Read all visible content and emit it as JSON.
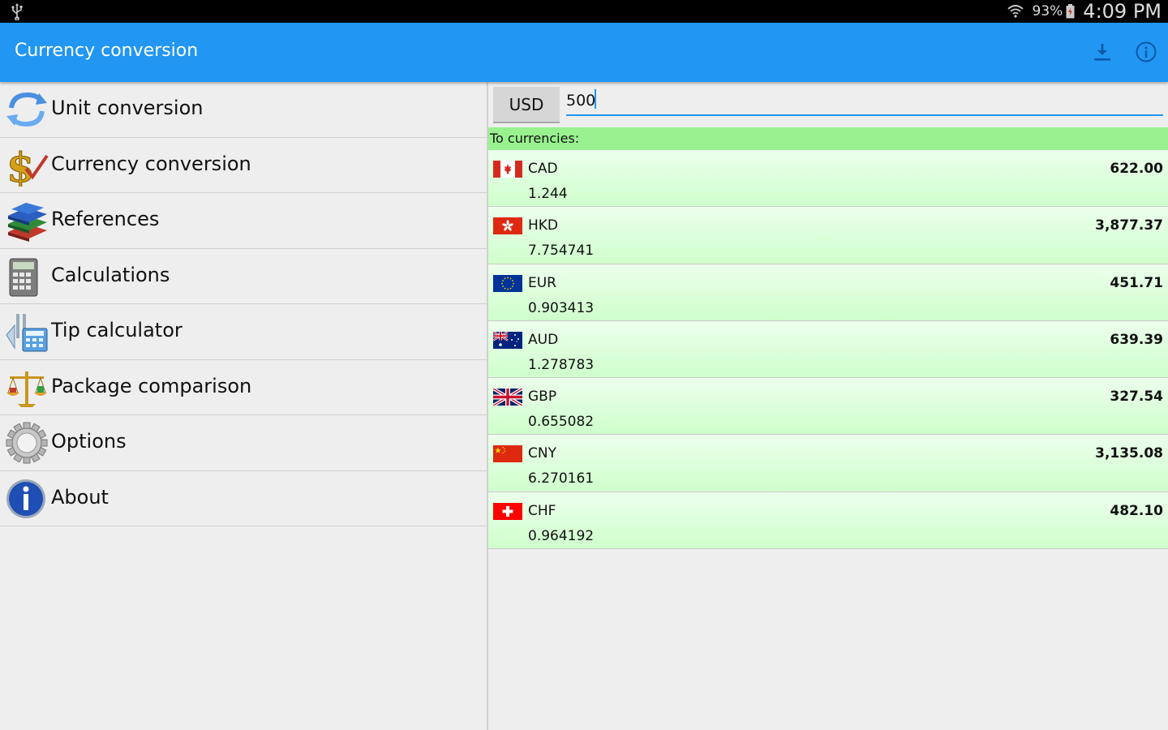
{
  "status_bar": {
    "battery_percent": "93%",
    "time": "4:09 PM",
    "icons": [
      "usb-icon",
      "wifi-icon",
      "battery-charging-icon"
    ]
  },
  "action_bar": {
    "title": "Currency conversion",
    "actions": [
      {
        "name": "download-icon"
      },
      {
        "name": "info-icon"
      }
    ],
    "color": "#2196f3"
  },
  "sidebar": {
    "items": [
      {
        "label": "Unit conversion",
        "icon": "unit-conversion-icon"
      },
      {
        "label": "Currency conversion",
        "icon": "dollar-icon"
      },
      {
        "label": "References",
        "icon": "books-icon"
      },
      {
        "label": "Calculations",
        "icon": "calculator-icon"
      },
      {
        "label": "Tip calculator",
        "icon": "tip-calculator-icon"
      },
      {
        "label": "Package comparison",
        "icon": "scale-icon"
      },
      {
        "label": "Options",
        "icon": "gear-icon"
      },
      {
        "label": "About",
        "icon": "info-icon"
      }
    ]
  },
  "converter": {
    "from_currency": "USD",
    "amount": "500",
    "to_header": "To currencies:",
    "header_color": "#99f28f",
    "rates": [
      {
        "code": "CAD",
        "rate": "1.244",
        "converted": "622.00",
        "flag": "canada-flag-icon"
      },
      {
        "code": "HKD",
        "rate": "7.754741",
        "converted": "3,877.37",
        "flag": "hong-kong-flag-icon"
      },
      {
        "code": "EUR",
        "rate": "0.903413",
        "converted": "451.71",
        "flag": "eu-flag-icon"
      },
      {
        "code": "AUD",
        "rate": "1.278783",
        "converted": "639.39",
        "flag": "australia-flag-icon"
      },
      {
        "code": "GBP",
        "rate": "0.655082",
        "converted": "327.54",
        "flag": "uk-flag-icon"
      },
      {
        "code": "CNY",
        "rate": "6.270161",
        "converted": "3,135.08",
        "flag": "china-flag-icon"
      },
      {
        "code": "CHF",
        "rate": "0.964192",
        "converted": "482.10",
        "flag": "switzerland-flag-icon"
      }
    ]
  }
}
